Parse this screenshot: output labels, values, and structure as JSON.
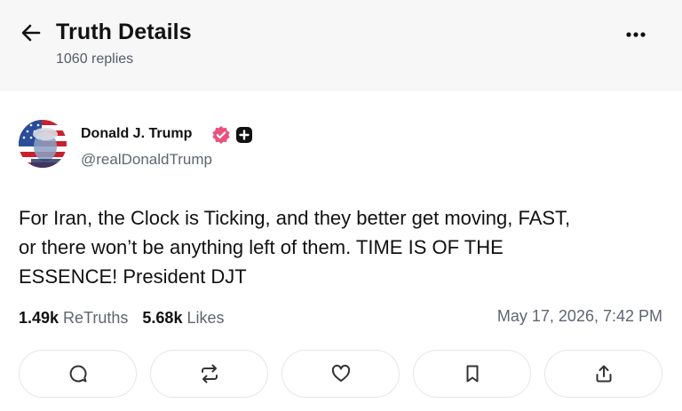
{
  "header": {
    "title": "Truth Details",
    "replies": "1060 replies"
  },
  "post": {
    "author_name": "Donald J. Trump",
    "handle": "@realDonaldTrump",
    "text": "For Iran, the Clock is Ticking, and they better get moving, FAST,\nor there won’t be anything left of them. TIME IS OF THE\nESSENCE! President DJT",
    "retruths_count": "1.49k",
    "retruths_label": "ReTruths",
    "likes_count": "5.68k",
    "likes_label": "Likes",
    "timestamp": "May 17, 2026, 7:42 PM"
  },
  "icons": {
    "back": "arrow-left-icon",
    "more": "more-dots-icon",
    "verified": "verified-badge-icon",
    "plus": "plus-badge-icon",
    "reply": "reply-icon",
    "retruth": "retruth-icon",
    "like": "heart-icon",
    "bookmark": "bookmark-icon",
    "share": "share-icon"
  },
  "colors": {
    "verified": "#e8527f",
    "header_bg": "#f7f7f8",
    "muted_text": "#5f6570"
  }
}
